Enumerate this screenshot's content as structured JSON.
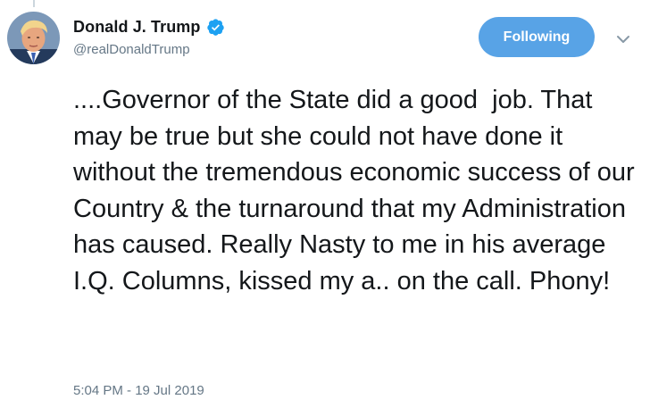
{
  "tweet": {
    "author": {
      "display_name": "Donald J. Trump",
      "handle": "@realDonaldTrump",
      "avatar_icon": "profile-photo",
      "verified_icon": "verified-badge-icon"
    },
    "follow_button_label": "Following",
    "menu_icon": "chevron-down-icon",
    "text": "....Governor of the State did a good  job. That may be true but she could not have done it without the tremendous economic success of our Country & the turnaround that my Administration has caused. Really Nasty to me in his average I.Q. Columns, kissed my a.. on the call. Phony!",
    "timestamp": "5:04 PM - 19 Jul 2019"
  },
  "colors": {
    "accent": "#58a3e6",
    "verified": "#1da1f2",
    "secondary_text": "#657786",
    "primary_text": "#14171a"
  }
}
